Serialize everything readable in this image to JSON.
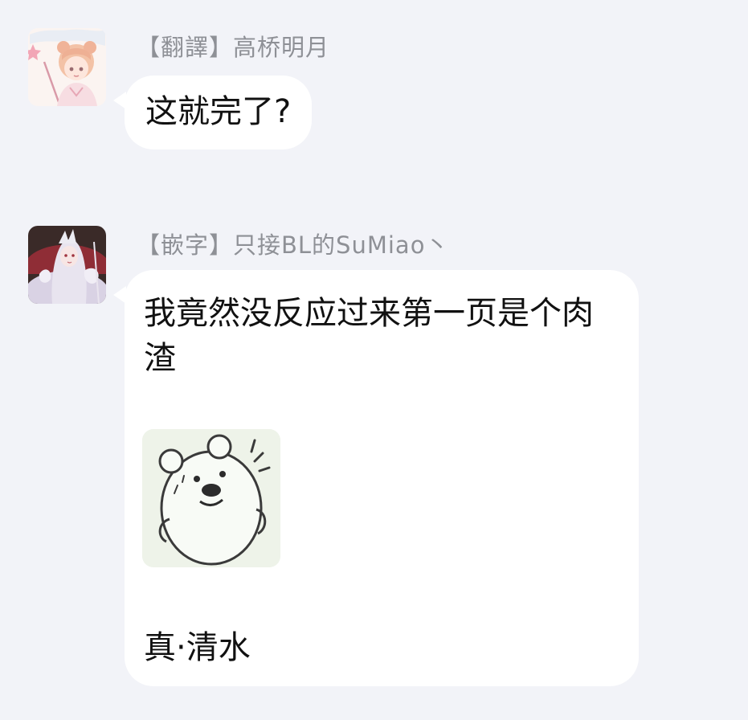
{
  "messages": [
    {
      "sender": "【翻譯】高桥明月",
      "text": "这就完了?"
    },
    {
      "sender": "【嵌字】只接BL的SuMiao丶",
      "text": "我竟然没反应过来第一页是个肉渣",
      "sticker": "bear-sticker",
      "after_text": "真·清水"
    }
  ],
  "colors": {
    "background": "#f2f3f8",
    "bubble": "#ffffff",
    "sender_name": "#8e9096",
    "message_text": "#111111"
  }
}
